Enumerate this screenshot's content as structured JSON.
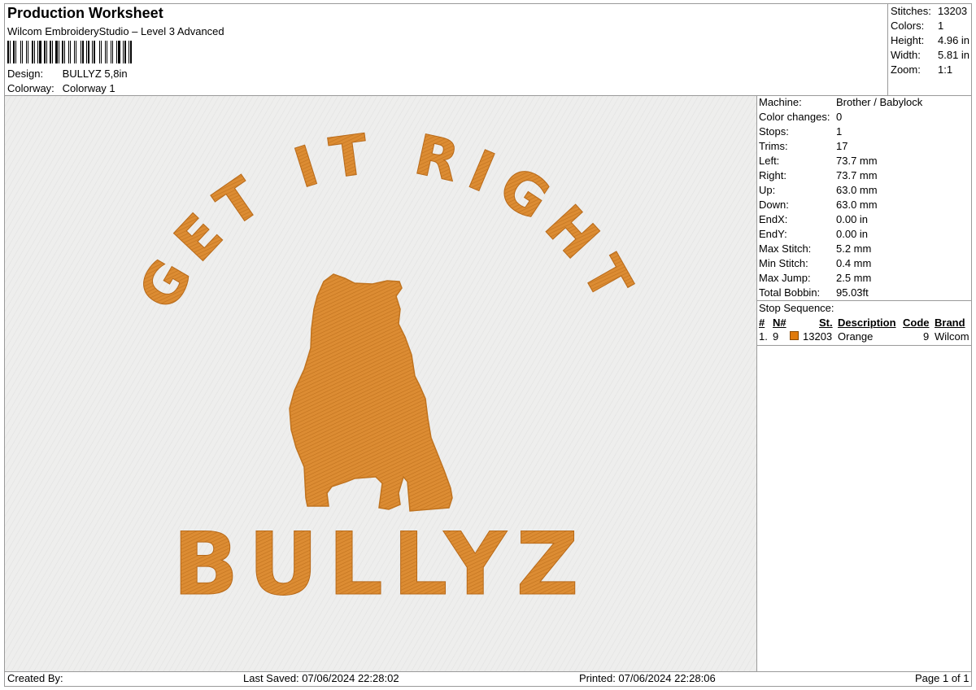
{
  "header": {
    "title": "Production Worksheet",
    "subtitle": "Wilcom EmbroideryStudio – Level 3 Advanced",
    "design_label": "Design:",
    "design_value": "BULLYZ 5,8in",
    "colorway_label": "Colorway:",
    "colorway_value": "Colorway 1"
  },
  "stats": [
    {
      "label": "Stitches:",
      "value": "13203"
    },
    {
      "label": "Colors:",
      "value": "1"
    },
    {
      "label": "Height:",
      "value": "4.96 in"
    },
    {
      "label": "Width:",
      "value": "5.81 in"
    },
    {
      "label": "Zoom:",
      "value": "1:1"
    }
  ],
  "properties": [
    {
      "label": "Machine:",
      "value": "Brother / Babylock"
    },
    {
      "label": "Color changes:",
      "value": "0"
    },
    {
      "label": "Stops:",
      "value": "1"
    },
    {
      "label": "Trims:",
      "value": "17"
    },
    {
      "label": "Left:",
      "value": "73.7 mm"
    },
    {
      "label": "Right:",
      "value": "73.7 mm"
    },
    {
      "label": "Up:",
      "value": "63.0 mm"
    },
    {
      "label": "Down:",
      "value": "63.0 mm"
    },
    {
      "label": "EndX:",
      "value": "0.00 in"
    },
    {
      "label": "EndY:",
      "value": "0.00 in"
    },
    {
      "label": "Max Stitch:",
      "value": "5.2 mm"
    },
    {
      "label": "Min Stitch:",
      "value": "0.4 mm"
    },
    {
      "label": "Max Jump:",
      "value": "2.5 mm"
    },
    {
      "label": "Total Bobbin:",
      "value": "95.03ft"
    }
  ],
  "stop_sequence": {
    "title": "Stop Sequence:",
    "headers": {
      "num": "#",
      "n": "N#",
      "st": "St.",
      "description": "Description",
      "code": "Code",
      "brand": "Brand"
    },
    "rows": [
      {
        "num": "1.",
        "n": "9",
        "st": "13203",
        "description": "Orange",
        "code": "9",
        "brand": "Wilcom",
        "color": "#e07a0b"
      }
    ]
  },
  "design": {
    "arc_text": "GET IT RIGHT",
    "bottom_text": "BULLYZ",
    "thread_color": "#dc8c33",
    "fabric_color": "#eeeeed"
  },
  "footer": {
    "created_by": "Created By:",
    "last_saved": "Last Saved: 07/06/2024 22:28:02",
    "printed": "Printed: 07/06/2024 22:28:06",
    "page": "Page 1 of 1"
  }
}
